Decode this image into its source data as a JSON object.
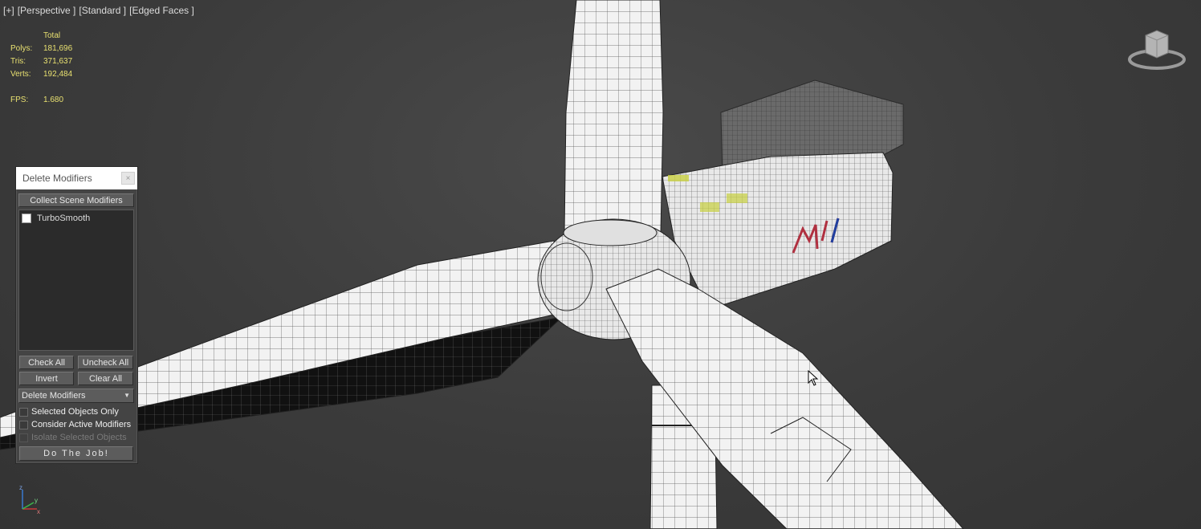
{
  "viewport": {
    "labels": [
      "[+]",
      "[Perspective ]",
      "[Standard ]",
      "[Edged Faces ]"
    ]
  },
  "stats": {
    "header": "Total",
    "polys_label": "Polys:",
    "polys": "181,696",
    "tris_label": "Tris:",
    "tris": "371,637",
    "verts_label": "Verts:",
    "verts": "192,484",
    "fps_label": "FPS:",
    "fps": "1.680"
  },
  "dialog": {
    "title": "Delete Modifiers",
    "close": "×",
    "collect_button": "Collect Scene Modifiers",
    "modifiers": [
      {
        "name": "TurboSmooth",
        "checked": false
      }
    ],
    "check_all": "Check All",
    "uncheck_all": "Uncheck All",
    "invert": "Invert",
    "clear_all": "Clear All",
    "mode_selected": "Delete Modifiers",
    "option_selected_only": "Selected Objects Only",
    "option_active_modifiers": "Consider Active Modifiers",
    "option_isolate": "Isolate Selected Objects",
    "do_job": "Do The Job!"
  },
  "axis": {
    "z": "z",
    "x": "x",
    "y": "y"
  },
  "colors": {
    "stats_text": "#e8e070",
    "dialog_bg": "#444444",
    "mesh_white": "#ffffff",
    "background": "#3a3a3a"
  }
}
